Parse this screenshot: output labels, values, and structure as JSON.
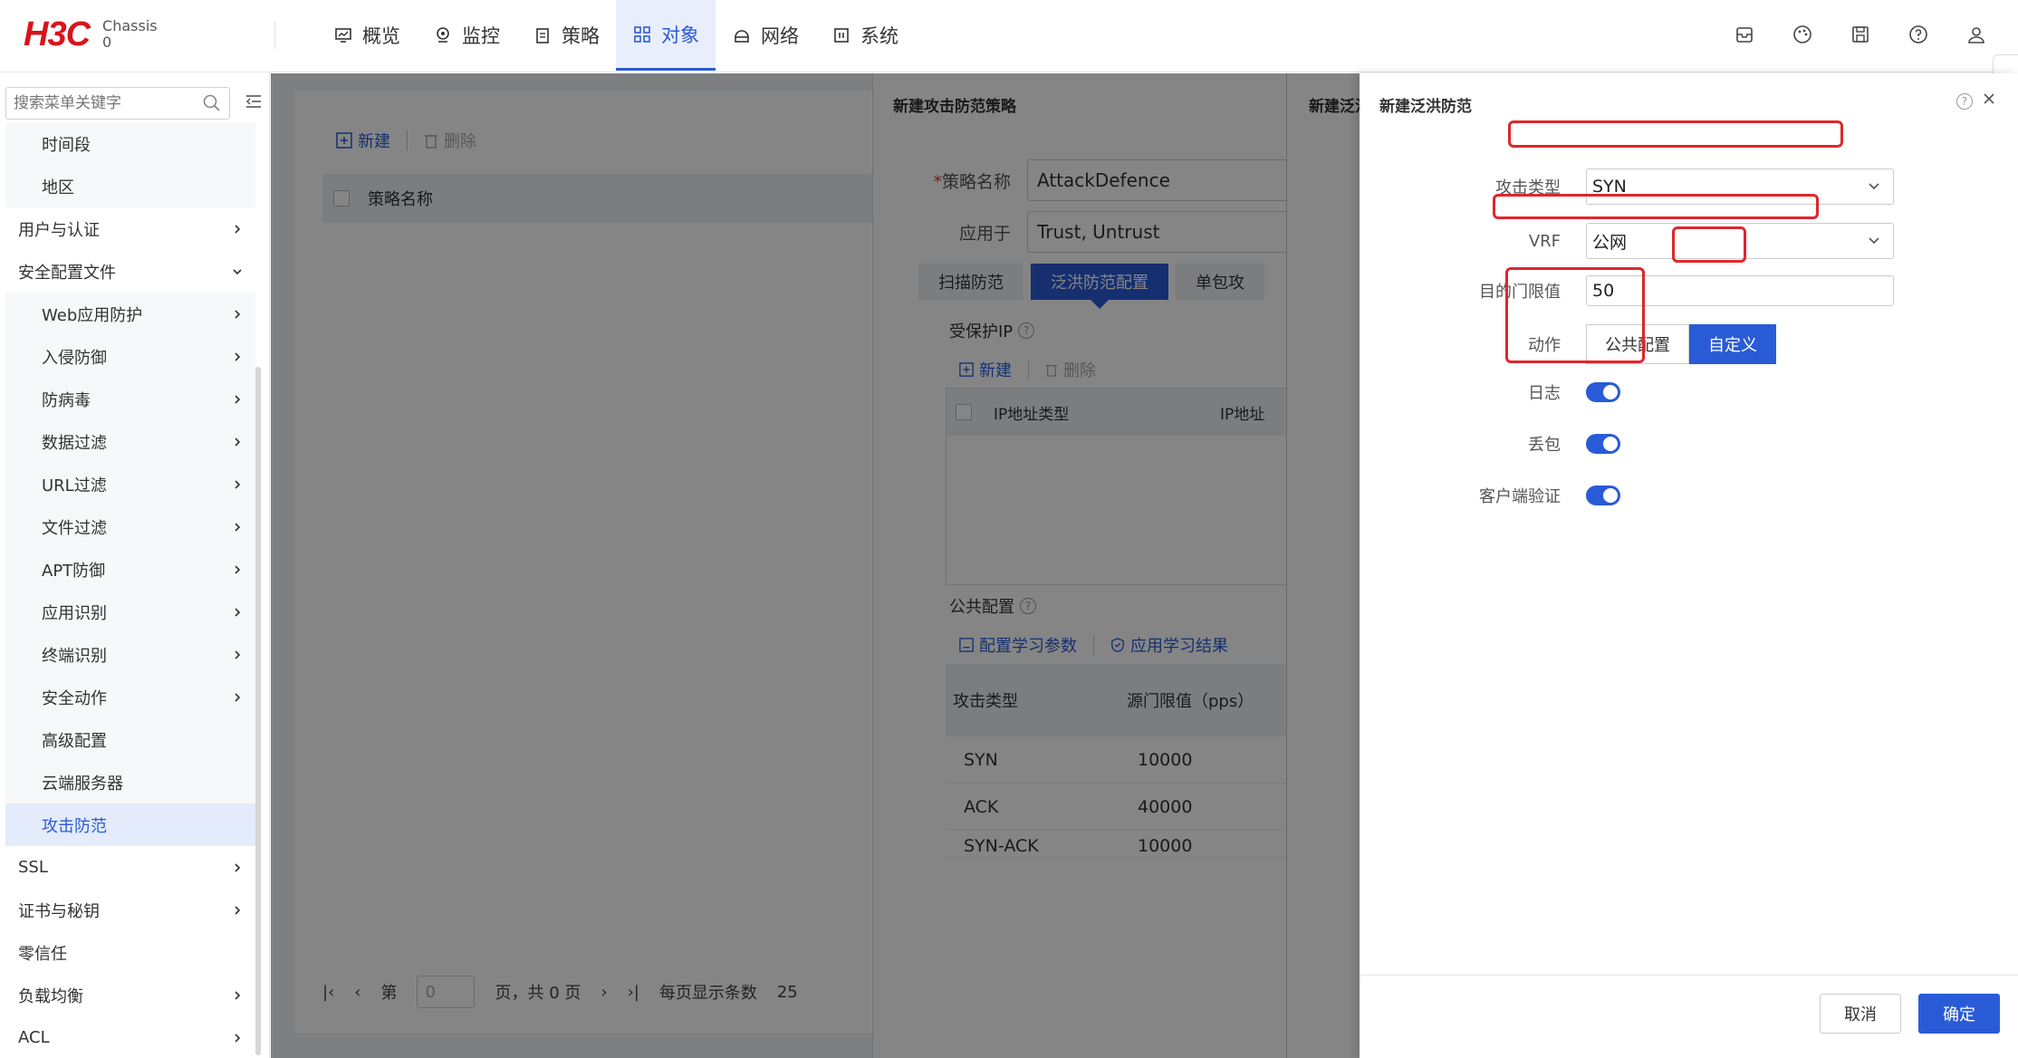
{
  "brand": {
    "logo": "H3C",
    "sub_line1": "Chassis",
    "sub_line2": "0"
  },
  "nav": [
    {
      "label": "概览",
      "icon": "monitor-icon"
    },
    {
      "label": "监控",
      "icon": "location-icon"
    },
    {
      "label": "策略",
      "icon": "clipboard-icon"
    },
    {
      "label": "对象",
      "icon": "grid-icon",
      "active": true
    },
    {
      "label": "网络",
      "icon": "network-icon"
    },
    {
      "label": "系统",
      "icon": "system-icon"
    }
  ],
  "sidebar": {
    "search_placeholder": "搜索菜单关键字",
    "items": [
      {
        "label": "时间段",
        "level": "sub"
      },
      {
        "label": "地区",
        "level": "sub"
      },
      {
        "label": "用户与认证",
        "level": "top",
        "chevron": "right"
      },
      {
        "label": "安全配置文件",
        "level": "top",
        "chevron": "down"
      },
      {
        "label": "Web应用防护",
        "level": "sub",
        "chevron": "right"
      },
      {
        "label": "入侵防御",
        "level": "sub",
        "chevron": "right"
      },
      {
        "label": "防病毒",
        "level": "sub",
        "chevron": "right"
      },
      {
        "label": "数据过滤",
        "level": "sub",
        "chevron": "right"
      },
      {
        "label": "URL过滤",
        "level": "sub",
        "chevron": "right"
      },
      {
        "label": "文件过滤",
        "level": "sub",
        "chevron": "right"
      },
      {
        "label": "APT防御",
        "level": "sub",
        "chevron": "right"
      },
      {
        "label": "应用识别",
        "level": "sub",
        "chevron": "right"
      },
      {
        "label": "终端识别",
        "level": "sub",
        "chevron": "right"
      },
      {
        "label": "安全动作",
        "level": "sub",
        "chevron": "right"
      },
      {
        "label": "高级配置",
        "level": "sub"
      },
      {
        "label": "云端服务器",
        "level": "sub"
      },
      {
        "label": "攻击防范",
        "level": "sub",
        "selected": true
      },
      {
        "label": "SSL",
        "level": "top",
        "chevron": "right"
      },
      {
        "label": "证书与秘钥",
        "level": "top",
        "chevron": "right"
      },
      {
        "label": "零信任",
        "level": "top"
      },
      {
        "label": "负载均衡",
        "level": "top",
        "chevron": "right"
      },
      {
        "label": "ACL",
        "level": "top",
        "chevron": "right"
      }
    ]
  },
  "main": {
    "toolbar": {
      "new_label": "新建",
      "delete_label": "删除"
    },
    "list_header": "策略名称",
    "pager": {
      "page_prefix": "第",
      "page_value": "0",
      "page_suffix": "页，共 0 页",
      "per_page_label": "每页显示条数",
      "per_page_value": "25"
    }
  },
  "drawer_policy": {
    "title": "新建攻击防范策略",
    "name_label": "策略名称",
    "name_value": "AttackDefence",
    "apply_label": "应用于",
    "apply_value": "Trust, Untrust",
    "tabs": [
      "扫描防范",
      "泛洪防范配置",
      "单包攻"
    ],
    "protected_ip_title": "受保护IP",
    "ip_toolbar": {
      "new_label": "新建",
      "delete_label": "删除"
    },
    "ip_columns": [
      "IP地址类型",
      "IP地址"
    ],
    "public_title": "公共配置",
    "public_toolbar": {
      "learn_params": "配置学习参数",
      "apply_result": "应用学习结果"
    },
    "public_columns": [
      "攻击类型",
      "源门限值（pps）"
    ],
    "public_rows": [
      {
        "type": "SYN",
        "value": "10000"
      },
      {
        "type": "ACK",
        "value": "40000"
      },
      {
        "type": "SYN-ACK",
        "value": "10000"
      }
    ]
  },
  "drawer_stub": {
    "title": "新建泛洪"
  },
  "drawer_flood": {
    "title": "新建泛洪防范",
    "attack_type_label": "攻击类型",
    "attack_type_value": "SYN",
    "vrf_label": "VRF",
    "vrf_value": "公网",
    "threshold_label": "目的门限值",
    "threshold_value": "50",
    "action_label": "动作",
    "action_options": [
      "公共配置",
      "自定义"
    ],
    "action_selected": "自定义",
    "log_label": "日志",
    "drop_label": "丢包",
    "client_verify_label": "客户端验证",
    "log_on": true,
    "drop_on": true,
    "client_verify_on": true,
    "cancel_label": "取消",
    "ok_label": "确定"
  },
  "colors": {
    "accent": "#2a5bd7",
    "highlight": "#e0262d",
    "brand": "#d8141b"
  }
}
